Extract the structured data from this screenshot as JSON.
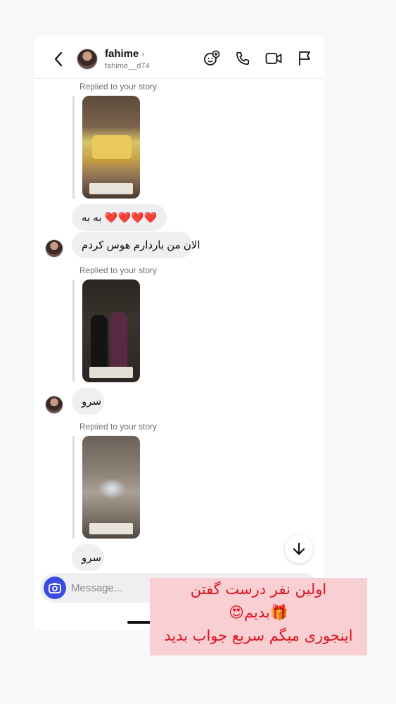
{
  "header": {
    "display_name": "fahime",
    "chevron": "›",
    "username": "fahime__d74",
    "icons": [
      "back-arrow-icon",
      "add-friend-icon",
      "phone-icon",
      "video-camera-icon",
      "flag-icon"
    ]
  },
  "thread": {
    "replied_label_1": "Replied to your story",
    "replied_label_2": "Replied to your story",
    "replied_label_3": "Replied to your story",
    "messages": [
      {
        "text": "به به ❤️❤️❤️❤️"
      },
      {
        "text": "الان من باردارم هوس کردم"
      },
      {
        "text": "سرو"
      },
      {
        "text": "سرو"
      }
    ]
  },
  "composer": {
    "placeholder": "Message..."
  },
  "overlay": {
    "line1": "اولین نفر درست گفتن",
    "line2": "🎁بدیم😍",
    "line3": "اینجوری میگم سریع جواب بدید"
  },
  "colors": {
    "accent": "#3a4be0",
    "overlay_bg": "#f8cfd2",
    "overlay_text": "#e0131f",
    "bubble": "#efeff2"
  }
}
